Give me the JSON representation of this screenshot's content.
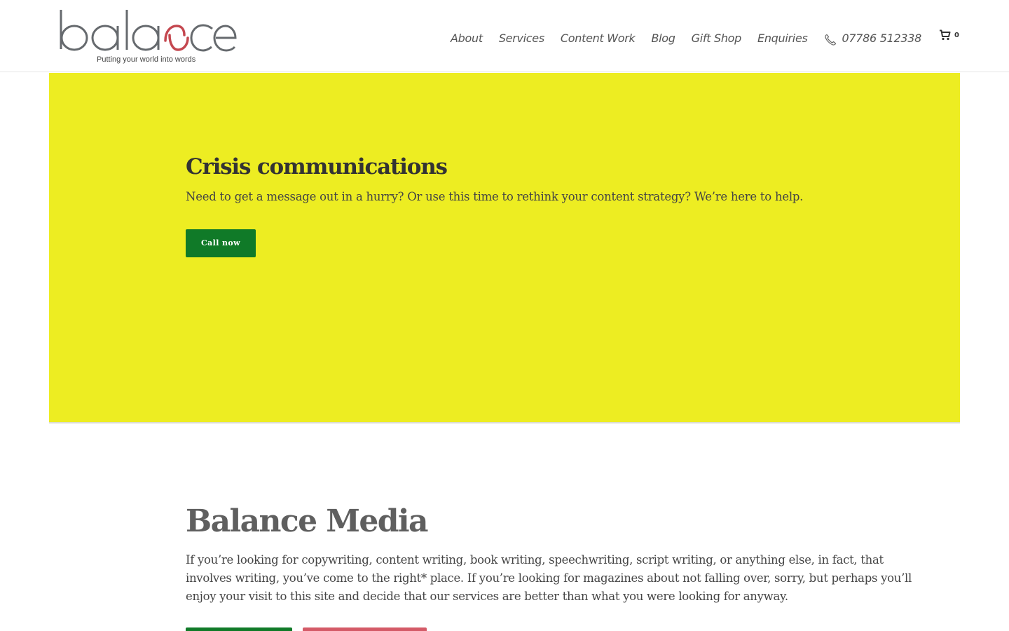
{
  "header": {
    "logo": {
      "wordmark": "balance",
      "tagline": "Putting your world into words"
    },
    "nav": {
      "items": [
        {
          "label": "About"
        },
        {
          "label": "Services"
        },
        {
          "label": "Content Work"
        },
        {
          "label": "Blog"
        },
        {
          "label": "Gift Shop"
        },
        {
          "label": "Enquiries"
        }
      ],
      "phone": {
        "icon": "phone-icon",
        "number": "07786 512338"
      }
    },
    "cart": {
      "icon": "cart-icon",
      "count": "0"
    }
  },
  "hero": {
    "title": "Crisis communications",
    "text": "Need to get a message out in a hurry? Or use this time to rethink your content strategy? We’re here to help.",
    "button_label": "Call now",
    "background_color": "#eded22",
    "button_color": "#107a28"
  },
  "intro": {
    "title": "Balance Media",
    "text_lines": [
      "If you’re looking for copywriting, content writing, book writing, speechwriting, script writing, or anything else, in fact, that",
      "involves writing, you’ve come to the right* place. If you’re looking for magazines about not falling over, sorry, but perhaps you’ll",
      "enjoy your visit to this site and decide that our services are better than what you were looking for anyway."
    ],
    "button_colors": [
      "#107a28",
      "#d45a67"
    ]
  },
  "colors": {
    "logo_gray": "#666a6e",
    "logo_accent": "#c4474f",
    "text_dark": "#333333"
  }
}
